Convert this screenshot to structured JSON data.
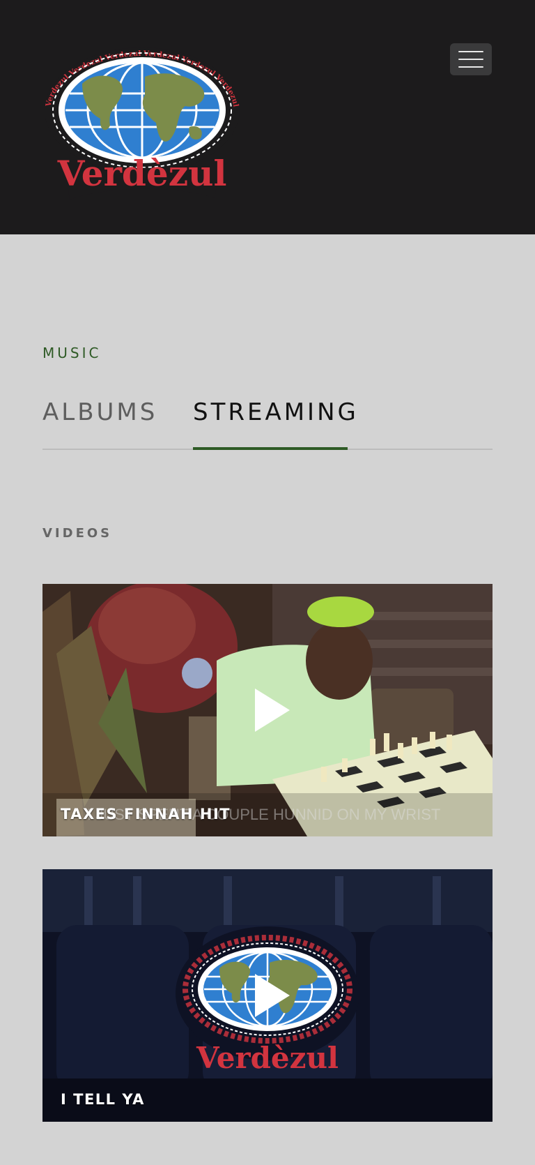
{
  "header": {
    "logo_text": "Verdèzul",
    "logo_ring_text": "Verdezul Verdezul Verdezul Verdezul Verdezul Verdezul Verdezul Verdezul",
    "menu_icon": "hamburger-menu-icon"
  },
  "music": {
    "section_label": "MUSIC",
    "tabs": [
      {
        "label": "ALBUMS",
        "active": false
      },
      {
        "label": "STREAMING",
        "active": true
      }
    ],
    "accent_color": "#2e5a25"
  },
  "videos": {
    "section_label": "VIDEOS",
    "items": [
      {
        "title": "TAXES FINNAH HIT",
        "caption": "I JUST SPENT A COUPLE HUNNID ON MY WRIST",
        "play_icon": "play-icon"
      },
      {
        "title": "I TELL YA",
        "play_icon": "play-icon"
      }
    ]
  }
}
